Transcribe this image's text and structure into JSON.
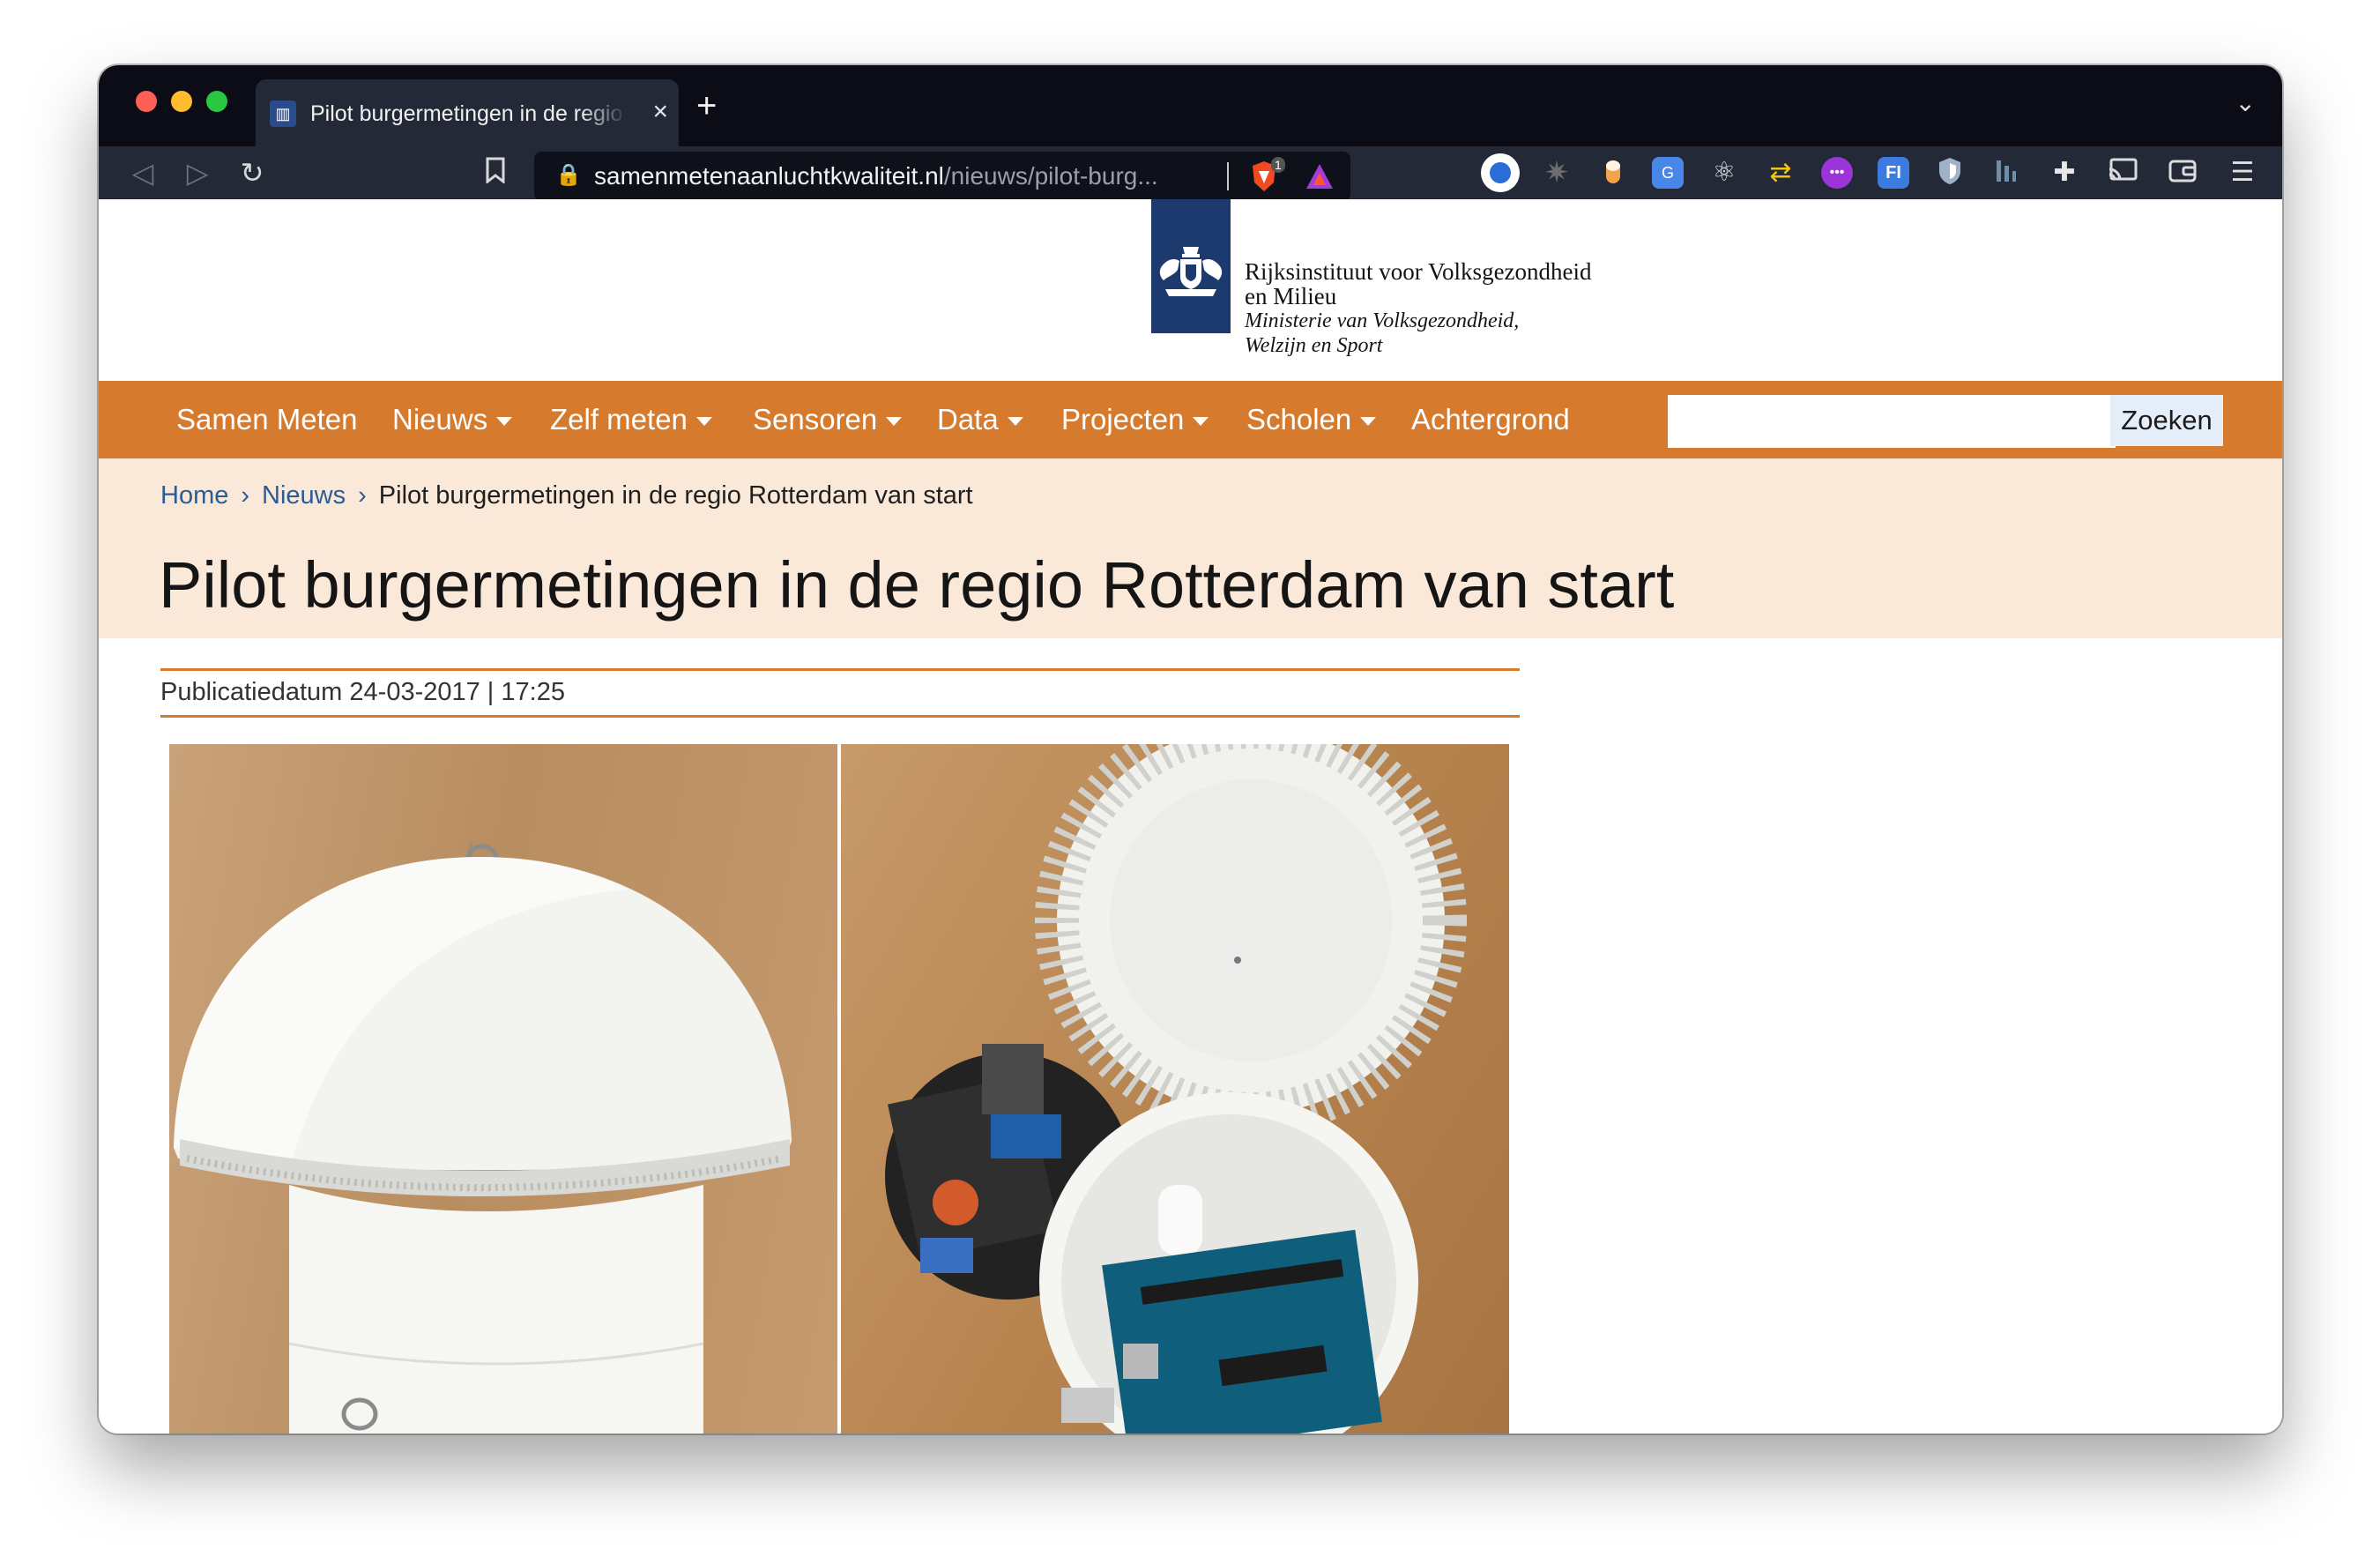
{
  "browser": {
    "tab_title": "Pilot burgermetingen in de regio Rotterdam van start",
    "tab_favicon": "rivm-favicon",
    "new_tab_label": "+",
    "url_host": "samenmetenaanluchtkwaliteit.nl",
    "url_path": "/nieuws/pilot-burg...",
    "brave_shield_count": "1",
    "extensions": [
      "ext-circle-icon",
      "ext-gear-icon",
      "ext-capsule-icon",
      "ext-translate-icon",
      "ext-react-icon",
      "ext-sync-icon",
      "ext-purple-icon",
      "ext-fi-icon",
      "ext-shield-icon",
      "ext-bars-icon",
      "puzzle-icon",
      "cast-icon",
      "wallet-icon",
      "menu-icon"
    ],
    "ext_fi_label": "FI"
  },
  "header": {
    "org_line1": "Rijksinstituut voor Volksgezondheid",
    "org_line2": "en Milieu",
    "ministry_line1": "Ministerie van Volksgezondheid,",
    "ministry_line2": "Welzijn en Sport"
  },
  "nav": {
    "items": [
      {
        "label": "Samen Meten",
        "dropdown": false
      },
      {
        "label": "Nieuws",
        "dropdown": true
      },
      {
        "label": "Zelf meten",
        "dropdown": true
      },
      {
        "label": "Sensoren",
        "dropdown": true
      },
      {
        "label": "Data",
        "dropdown": true
      },
      {
        "label": "Projecten",
        "dropdown": true
      },
      {
        "label": "Scholen",
        "dropdown": true
      },
      {
        "label": "Achtergrond",
        "dropdown": false
      }
    ],
    "search_value": "",
    "search_button": "Zoeken"
  },
  "breadcrumb": {
    "home": "Home",
    "section": "Nieuws",
    "separator": "›",
    "current": "Pilot burgermetingen in de regio Rotterdam van start"
  },
  "article": {
    "title": "Pilot burgermetingen in de regio Rotterdam van start",
    "published": "Publicatiedatum 24-03-2017 | 17:25"
  },
  "colors": {
    "nav_orange": "#d67a2e",
    "header_band": "#fae9d9",
    "logo_blue": "#1c3a6e",
    "link_blue": "#2a5d96"
  }
}
